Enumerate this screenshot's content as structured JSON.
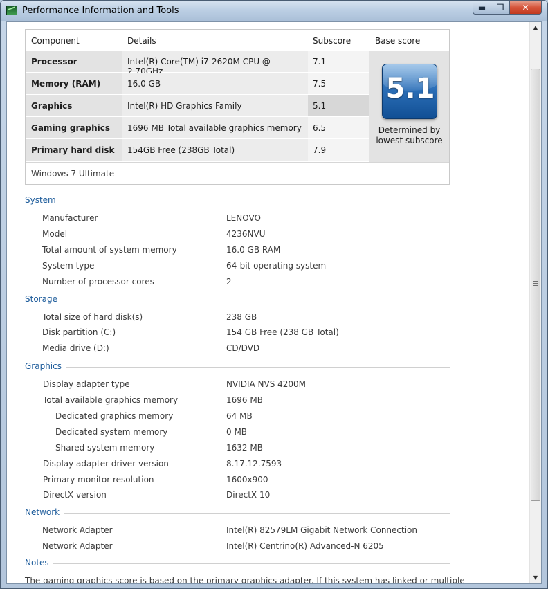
{
  "window": {
    "title": "Performance Information and Tools",
    "min_label": "▬",
    "max_label": "❐",
    "close_label": "✕"
  },
  "score_table": {
    "headers": {
      "component": "Component",
      "details": "Details",
      "subscore": "Subscore",
      "base_score": "Base score"
    },
    "rows": [
      {
        "component": "Processor",
        "details": "Intel(R) Core(TM) i7-2620M CPU @ 2.70GHz",
        "subscore": "7.1"
      },
      {
        "component": "Memory (RAM)",
        "details": "16.0 GB",
        "subscore": "7.5"
      },
      {
        "component": "Graphics",
        "details": "Intel(R) HD Graphics Family",
        "subscore": "5.1"
      },
      {
        "component": "Gaming graphics",
        "details": "1696 MB Total available graphics memory",
        "subscore": "6.5"
      },
      {
        "component": "Primary hard disk",
        "details": "154GB Free (238GB Total)",
        "subscore": "7.9"
      }
    ],
    "base_score": "5.1",
    "base_note": "Determined by lowest subscore",
    "os": "Windows 7 Ultimate"
  },
  "system": {
    "title": "System",
    "items": [
      {
        "label": "Manufacturer",
        "value": "LENOVO"
      },
      {
        "label": "Model",
        "value": "4236NVU"
      },
      {
        "label": "Total amount of system memory",
        "value": "16.0 GB RAM"
      },
      {
        "label": "System type",
        "value": "64-bit operating system"
      },
      {
        "label": "Number of processor cores",
        "value": "2"
      }
    ]
  },
  "storage": {
    "title": "Storage",
    "items": [
      {
        "label": "Total size of hard disk(s)",
        "value": "238 GB"
      },
      {
        "label": "Disk partition (C:)",
        "value": "154 GB Free (238 GB Total)"
      },
      {
        "label": "Media drive (D:)",
        "value": "CD/DVD"
      }
    ]
  },
  "graphics": {
    "title": "Graphics",
    "items": [
      {
        "label": "Display adapter type",
        "value": "NVIDIA NVS 4200M"
      },
      {
        "label": "Total available graphics memory",
        "value": "1696 MB"
      },
      {
        "label": "Dedicated graphics memory",
        "value": "64 MB"
      },
      {
        "label": "Dedicated system memory",
        "value": "0 MB"
      },
      {
        "label": "Shared system memory",
        "value": "1632 MB"
      },
      {
        "label": "Display adapter driver version",
        "value": "8.17.12.7593"
      },
      {
        "label": "Primary monitor resolution",
        "value": "1600x900"
      },
      {
        "label": "DirectX version",
        "value": "DirectX 10"
      }
    ]
  },
  "network": {
    "title": "Network",
    "items": [
      {
        "label": "Network Adapter",
        "value": "Intel(R) 82579LM Gigabit Network Connection"
      },
      {
        "label": "Network Adapter",
        "value": "Intel(R) Centrino(R) Advanced-N 6205"
      }
    ]
  },
  "notes": {
    "title": "Notes",
    "text": "The gaming graphics score is based on the primary graphics adapter. If this system has linked or multiple"
  }
}
